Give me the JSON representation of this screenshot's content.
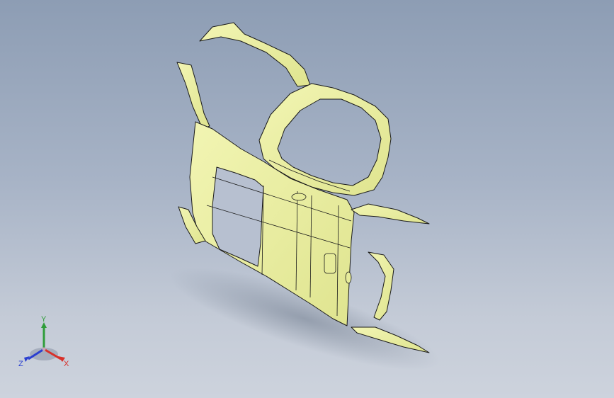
{
  "triad": {
    "x_label": "X",
    "y_label": "Y",
    "z_label": "Z",
    "colors": {
      "x": "#d8302a",
      "y": "#2f9d3a",
      "z": "#2a3fd0"
    }
  },
  "viewport": {
    "background_top": "#8d9db4",
    "background_bottom": "#cdd3dd",
    "part_color": "#eef2a6",
    "part_shade": "#d9df86",
    "edge_color": "#1a1a1a"
  }
}
